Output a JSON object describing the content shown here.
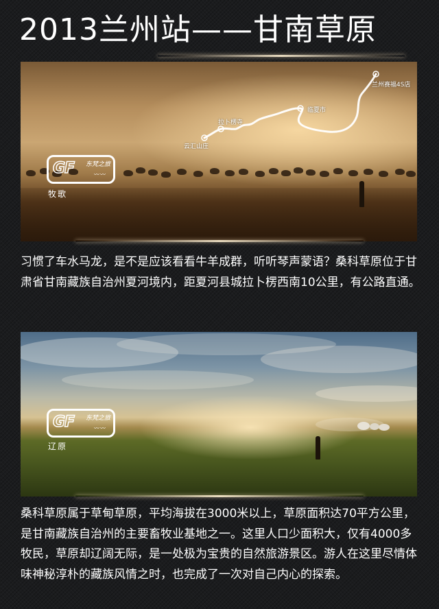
{
  "title": "2013兰州站——甘南草原",
  "section1": {
    "route_labels": [
      "兰州赛福4S店",
      "临夏市",
      "拉卜楞寺",
      "云汇山庄"
    ],
    "logo_text": "GF",
    "logo_script": "东梵之旅",
    "caption": "牧歌",
    "paragraph": "习惯了车水马龙，是不是应该看看牛羊成群，听听琴声蒙语？桑科草原位于甘肃省甘南藏族自治州夏河境内，距夏河县城拉卜楞西南10公里，有公路直通。"
  },
  "section2": {
    "logo_text": "GF",
    "logo_script": "东梵之旅",
    "caption": "辽原",
    "paragraph": "桑科草原属于草甸草原，平均海拔在3000米以上，草原面积达70平方公里，是甘南藏族自治州的主要畜牧业基地之一。这里人口少面积大，仅有4000多牧民，草原却辽阔无际，是一处极为宝贵的自然旅游景区。游人在这里尽情体味神秘淳朴的藏族风情之时，也完成了一次对自己内心的探索。"
  },
  "colors": {
    "background": "#1b1c1e",
    "text": "#ffffff",
    "glow": "#fff0d2"
  },
  "icons": [
    "route-map-icon",
    "gf-logo-icon"
  ]
}
